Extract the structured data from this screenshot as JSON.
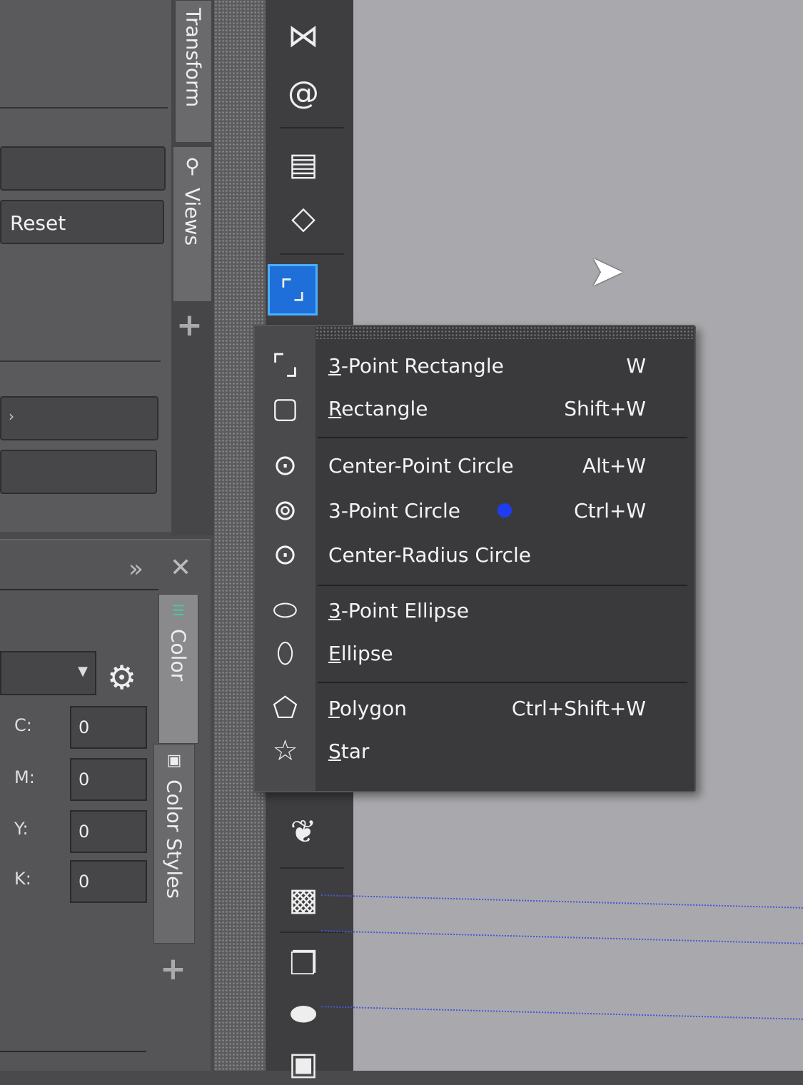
{
  "docker_top": {
    "reset_label": "Reset",
    "tabs": [
      {
        "label": "Transform"
      },
      {
        "label": "Views"
      }
    ],
    "add_label": "+"
  },
  "color_docker": {
    "tabs": [
      {
        "label": "Color"
      },
      {
        "label": "Color Styles"
      }
    ],
    "add_label": "+",
    "channels": [
      {
        "label": "C:",
        "value": "0"
      },
      {
        "label": "M:",
        "value": "0"
      },
      {
        "label": "Y:",
        "value": "0"
      },
      {
        "label": "K:",
        "value": "0"
      }
    ]
  },
  "flyout": {
    "items": [
      {
        "mn": "3",
        "rest": "-Point Rectangle",
        "shortcut": "W",
        "icon": "3-point-rectangle-icon"
      },
      {
        "mn": "R",
        "rest": "ectangle",
        "shortcut": "Shift+W",
        "icon": "rectangle-icon"
      },
      {
        "mn": "",
        "rest": "Center-Point Circle",
        "shortcut": "Alt+W",
        "icon": "center-point-circle-icon"
      },
      {
        "mn": "",
        "rest": "3-Point Circle",
        "shortcut": "Ctrl+W",
        "icon": "3-point-circle-icon"
      },
      {
        "mn": "",
        "rest": "Center-Radius Circle",
        "shortcut": "",
        "icon": "center-radius-circle-icon"
      },
      {
        "mn": "3",
        "rest": "-Point Ellipse",
        "shortcut": "",
        "icon": "3-point-ellipse-icon"
      },
      {
        "mn": "E",
        "rest": "llipse",
        "shortcut": "",
        "icon": "ellipse-icon"
      },
      {
        "mn": "P",
        "rest": "olygon",
        "shortcut": "Ctrl+Shift+W",
        "icon": "polygon-icon"
      },
      {
        "mn": "S",
        "rest": "tar",
        "shortcut": "",
        "icon": "star-icon"
      }
    ]
  },
  "colors": {
    "accent": "#1e6fd9",
    "canvas": "#a9a9ad",
    "guide": "#4a55d8",
    "indicator_dot": "#1f3cf0"
  }
}
